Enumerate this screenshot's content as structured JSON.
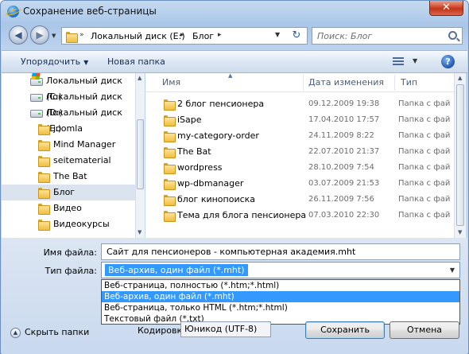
{
  "window": {
    "title": "Сохранение веб-страницы",
    "close_glyph": "✕"
  },
  "address": {
    "path": [
      "Локальный диск (E:)",
      "Блог"
    ],
    "search_placeholder": "Поиск: Блог"
  },
  "toolbar": {
    "organize_label": "Упорядочить",
    "new_folder_label": "Новая папка"
  },
  "nav_tree": [
    {
      "label": "Локальный диск (C:)",
      "icon": "system-drive-icon"
    },
    {
      "label": "Локальный диск (D:)",
      "icon": "drive-icon"
    },
    {
      "label": "Локальный диск (E:)",
      "icon": "drive-icon"
    },
    {
      "label": "joomla",
      "icon": "folder-icon"
    },
    {
      "label": "Mind Manager",
      "icon": "folder-icon"
    },
    {
      "label": "seitematerial",
      "icon": "folder-icon"
    },
    {
      "label": "The Bat",
      "icon": "folder-icon"
    },
    {
      "label": "Блог",
      "icon": "folder-icon",
      "selected": true
    },
    {
      "label": "Видео",
      "icon": "folder-icon"
    },
    {
      "label": "Видеокурсы",
      "icon": "folder-icon"
    }
  ],
  "columns": {
    "name": "Имя",
    "date": "Дата изменения",
    "type": "Тип"
  },
  "files": [
    {
      "name": "2 блог пенсионера",
      "date": "09.12.2009 19:38",
      "type": "Папка с фай"
    },
    {
      "name": "iSape",
      "date": "17.04.2010 17:57",
      "type": "Папка с фай"
    },
    {
      "name": "my-category-order",
      "date": "24.11.2009 8:22",
      "type": "Папка с фай"
    },
    {
      "name": "The Bat",
      "date": "22.07.2010 21:37",
      "type": "Папка с фай"
    },
    {
      "name": "wordpress",
      "date": "28.10.2009 7:54",
      "type": "Папка с фай"
    },
    {
      "name": "wp-dbmanager",
      "date": "03.07.2009 21:53",
      "type": "Папка с фай"
    },
    {
      "name": "блог кинопоиска",
      "date": "26.11.2009 7:56",
      "type": "Папка с фай"
    },
    {
      "name": "Тема для блога пенсионера",
      "date": "07.03.2010 22:30",
      "type": "Папка с фай"
    }
  ],
  "form": {
    "filename_label_prefix": "Имя файла:",
    "filename_value": "Сайт для пенсионеров - компьютерная академия.mht",
    "filetype_label": "Тип файла:",
    "filetype_value": "Веб-архив, один файл  (*.mht)",
    "filetype_options": [
      "Веб-страница, полностью (*.htm;*.html)",
      "Веб-архив, один файл  (*.mht)",
      "Веб-страница, только HTML (*.htm;*.html)",
      "Текстовый файл (*.txt)"
    ],
    "hide_folders_label": "Скрыть папки",
    "encoding_label": "Кодировка:",
    "encoding_value": "Юникод (UTF-8)",
    "save_label": "Сохранить",
    "cancel_label": "Отмена"
  }
}
